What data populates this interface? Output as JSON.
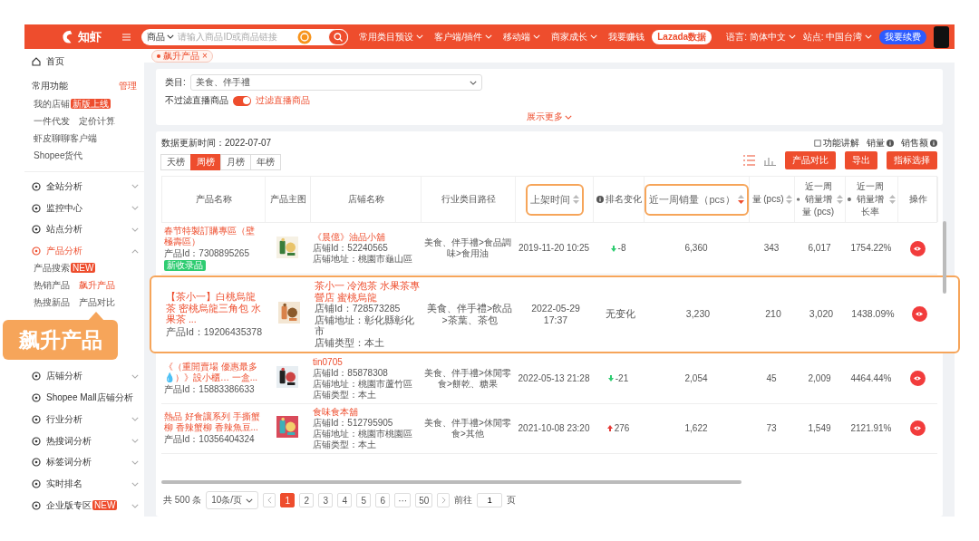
{
  "top_bar": {
    "logo": "知虾",
    "search": {
      "scope": "商品",
      "placeholder": "请输入商品ID或商品链接"
    },
    "nav": [
      {
        "label": "常用类目预设",
        "dropdown": true
      },
      {
        "label": "客户端/插件",
        "dropdown": true
      },
      {
        "label": "移动端",
        "dropdown": true
      },
      {
        "label": "商家成长",
        "dropdown": true
      },
      {
        "label": "我要赚钱",
        "dropdown": false
      }
    ],
    "lazada": "Lazada数据",
    "language": {
      "label": "语言:",
      "value": "简体中文"
    },
    "site": {
      "label": "站点:",
      "value": "中国台湾"
    },
    "renew": "我要续费"
  },
  "page_tabs": [
    {
      "label": "飙升产品",
      "close": "×",
      "selected": true
    }
  ],
  "sidebar": {
    "home": "首页",
    "common": {
      "title": "常用功能",
      "manage": "管理",
      "items": [
        {
          "label": "我的店铺",
          "badge": "新版上线"
        },
        {
          "label": "一件代发"
        },
        {
          "label": "定价计算"
        },
        {
          "label": "虾皮聊聊客户端"
        },
        {
          "label": "Shopee货代"
        }
      ]
    },
    "groups": [
      {
        "label": "全站分析",
        "expanded": false
      },
      {
        "label": "监控中心",
        "expanded": false
      },
      {
        "label": "站点分析",
        "expanded": false
      },
      {
        "label": "产品分析",
        "expanded": true,
        "children": [
          {
            "label": "产品搜索",
            "badge": "NEW",
            "selected": false
          },
          {
            "label": "热销产品",
            "selected": false
          },
          {
            "label": "飙升产品",
            "selected": true
          },
          {
            "label": "热搜新品",
            "selected": false
          },
          {
            "label": "产品对比",
            "selected": false
          }
        ]
      },
      {
        "label": "店铺分析",
        "expanded": false
      },
      {
        "label": "Shopee Mall店铺分析",
        "expanded": false
      },
      {
        "label": "行业分析",
        "expanded": false
      },
      {
        "label": "热搜词分析",
        "expanded": false
      },
      {
        "label": "标签词分析",
        "expanded": false
      },
      {
        "label": "实时排名",
        "expanded": false
      },
      {
        "label": "企业版专区",
        "badge": "NEW",
        "expanded": false
      }
    ]
  },
  "callout": "飙升产品",
  "filters": {
    "category_label": "类目:",
    "category_value": "美食、伴手禮",
    "live_off_label": "不过滤直播商品",
    "live_filter": {
      "on": true,
      "label": "过滤直播商品"
    },
    "more": "展示更多"
  },
  "data_panel": {
    "updated": "数据更新时间：2022-07-07",
    "help": "功能讲解",
    "metrics": [
      "销量",
      "销售额"
    ],
    "periods": [
      {
        "label": "天榜",
        "selected": false
      },
      {
        "label": "周榜",
        "selected": true
      },
      {
        "label": "月榜",
        "selected": false
      },
      {
        "label": "年榜",
        "selected": false
      }
    ],
    "buttons": [
      "产品对比",
      "导出",
      "指标选择"
    ]
  },
  "table": {
    "columns": [
      {
        "label": "产品名称"
      },
      {
        "label": "产品主图"
      },
      {
        "label": "店铺名称"
      },
      {
        "label": "行业类目路径"
      },
      {
        "label": "上架时间",
        "sortable": true,
        "sort_active": false,
        "highlighted": true
      },
      {
        "label": "排名变化",
        "info": true
      },
      {
        "label": "近一周销量（pcs）",
        "sortable": true,
        "sort_active": true,
        "highlighted": true
      },
      {
        "label": "量 (pcs)",
        "sortable": true,
        "sort_active": false
      },
      {
        "label": "近一周销量增量 (pcs)",
        "info": true,
        "sortable": true,
        "sort_active": false
      },
      {
        "label": "近一周销量增长率",
        "info": true,
        "sortable": true,
        "sort_active": false
      },
      {
        "label": "操作"
      }
    ],
    "rows": [
      {
        "highlighted": false,
        "name": "春节特製訂購專區（壁極壽區）",
        "product_id": "产品Id：7308895265",
        "badge": "新收录品",
        "shop": "《晨億》油品小舖",
        "shop_lines": [
          "店铺Id：52240565",
          "店铺地址：桃園市龜山區"
        ],
        "category": "美食、伴手禮>食品調味>食用油",
        "listed": "2019-11-20 10:25",
        "rank": {
          "kind": "down",
          "text": "-8"
        },
        "sales": "6,360",
        "col_8": "343",
        "increase": "6,017",
        "growth": "1754.22%"
      },
      {
        "highlighted": true,
        "name": "【茶小一】白桃烏龍茶 密桃烏龍三角包 水果茶 ...",
        "product_id": "产品Id：19206435378",
        "shop": "茶小一 冷泡茶 水果茶專營店 蜜桃烏龍",
        "shop_lines": [
          "店铺Id：728573285",
          "店铺地址：彰化縣彰化市",
          "店铺类型：本土"
        ],
        "category": "美食、伴手禮>飲品>茶葉、茶包",
        "listed": "2022-05-29 17:37",
        "rank": {
          "kind": "none",
          "text": "无变化"
        },
        "sales": "3,230",
        "col_8": "210",
        "increase": "3,020",
        "growth": "1438.09%"
      },
      {
        "highlighted": false,
        "name": "《（重開賣場 優惠最多💧）》設小櫃… 一盒...",
        "product_id": "产品Id：15883386633",
        "shop": "tin0705",
        "shop_lines": [
          "店铺Id：85878308",
          "店铺地址：桃園市蘆竹區",
          "店铺类型：本土"
        ],
        "category": "美食、伴手禮>休閒零食>餅乾、糖果",
        "listed": "2022-05-13 21:28",
        "rank": {
          "kind": "down",
          "text": "-21"
        },
        "sales": "2,054",
        "col_8": "45",
        "increase": "2,009",
        "growth": "4464.44%"
      },
      {
        "highlighted": false,
        "name": "熱品 好食讓系列 手撕蟹柳 香辣蟹柳 香辣魚豆...",
        "product_id": "产品Id：10356404324",
        "shop": "食味食本舖",
        "shop_lines": [
          "店铺Id：512795905",
          "店铺地址：桃園市桃園區",
          "店铺类型：本土"
        ],
        "category": "美食、伴手禮>休閒零食>其他",
        "listed": "2021-10-08 23:20",
        "rank": {
          "kind": "up",
          "text": "276"
        },
        "sales": "1,622",
        "col_8": "73",
        "increase": "1,549",
        "growth": "2121.91%"
      }
    ]
  },
  "pagination": {
    "total": "共 500 条",
    "page_size": "10条/页",
    "pages": [
      {
        "label": "1",
        "selected": true
      },
      {
        "label": "2",
        "selected": false
      },
      {
        "label": "3",
        "selected": false
      },
      {
        "label": "4",
        "selected": false
      },
      {
        "label": "5",
        "selected": false
      },
      {
        "label": "6",
        "selected": false
      },
      {
        "label": "···",
        "selected": false
      },
      {
        "label": "50",
        "selected": false
      }
    ],
    "goto_label": "前往",
    "goto_value": "1",
    "goto_unit": "页"
  }
}
